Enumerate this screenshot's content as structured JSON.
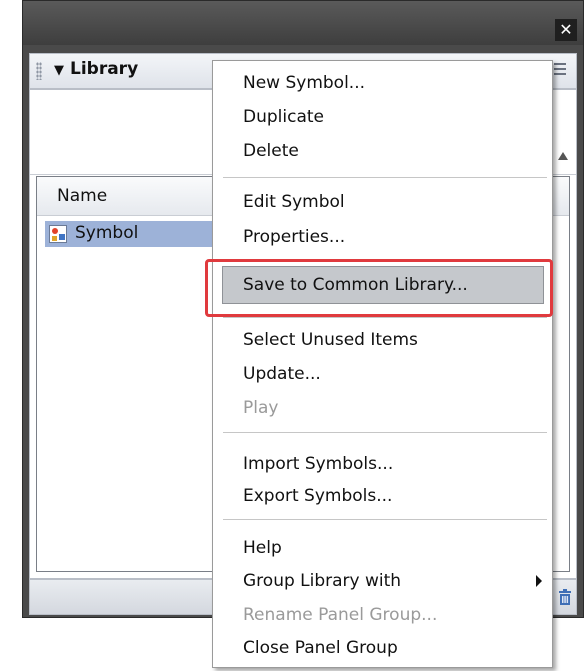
{
  "window": {
    "close_label": "✕"
  },
  "panel": {
    "title": "Library",
    "list_column_name": "Name",
    "items": [
      {
        "label": "Symbol",
        "icon": "symbol-icon"
      }
    ]
  },
  "context_menu": {
    "items": [
      {
        "label": "New Symbol...",
        "enabled": true
      },
      {
        "label": "Duplicate",
        "enabled": true
      },
      {
        "label": "Delete",
        "enabled": true
      },
      {
        "label": "Edit Symbol",
        "enabled": true
      },
      {
        "label": "Properties...",
        "enabled": true
      },
      {
        "label": "Save to Common Library...",
        "enabled": true,
        "highlighted": true
      },
      {
        "label": "Select Unused Items",
        "enabled": true
      },
      {
        "label": "Update...",
        "enabled": true
      },
      {
        "label": "Play",
        "enabled": false
      },
      {
        "label": "Import Symbols...",
        "enabled": true
      },
      {
        "label": "Export Symbols...",
        "enabled": true
      },
      {
        "label": "Help",
        "enabled": true
      },
      {
        "label": "Group Library with",
        "enabled": true,
        "submenu": true
      },
      {
        "label": "Rename Panel Group...",
        "enabled": false
      },
      {
        "label": "Close Panel Group",
        "enabled": true
      }
    ]
  },
  "colors": {
    "highlight_border": "#e03a3e",
    "selected_row": "#9db2d8",
    "disabled_text": "#9a9a9a"
  }
}
